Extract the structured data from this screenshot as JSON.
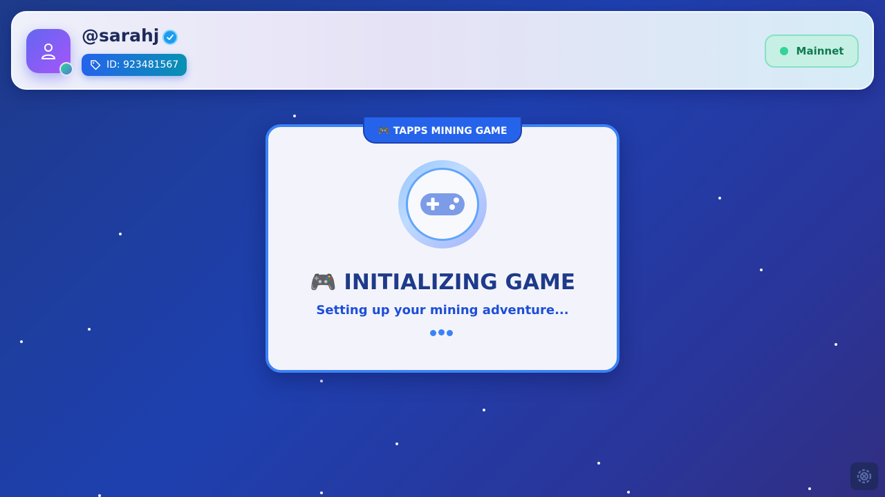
{
  "header": {
    "username": "@sarahj",
    "id_label": "ID: 923481567",
    "network": "Mainnet",
    "icons": {
      "avatar": "user-icon",
      "verified": "check-badge-icon",
      "id": "tag-icon"
    }
  },
  "card": {
    "tag": "🎮 TAPPS MINING GAME",
    "title": "🎮 INITIALIZING GAME",
    "subtitle": "Setting up your mining adventure...",
    "icon": "gamepad-icon"
  },
  "corner": {
    "icon": "settings-gear-icon"
  },
  "colors": {
    "accent": "#3b82f6",
    "title": "#1e3a8a",
    "network_text": "#0f7a50",
    "network_dot": "#34d399"
  }
}
